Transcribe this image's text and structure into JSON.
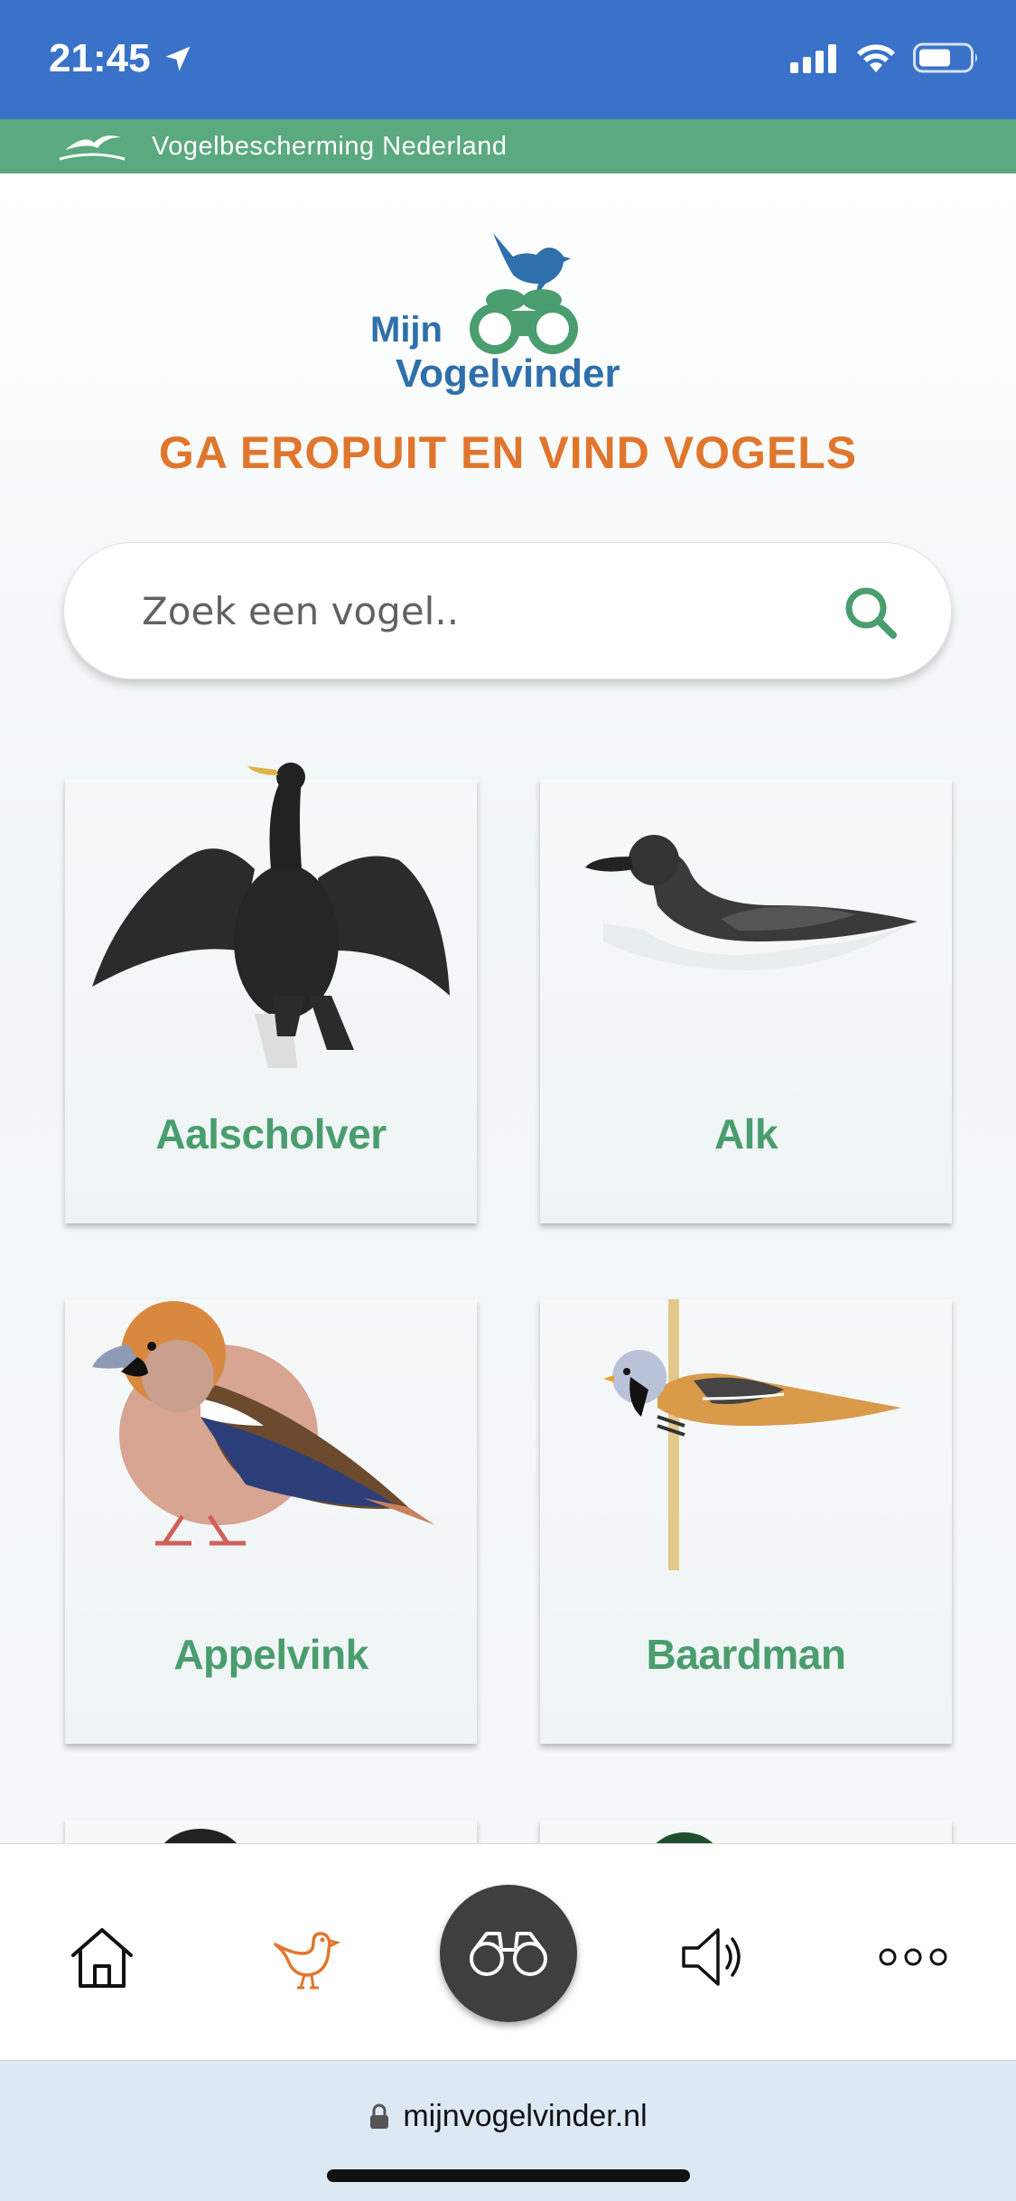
{
  "status_bar": {
    "time": "21:45",
    "icons": [
      "location-arrow-icon",
      "cellular-signal-icon",
      "wifi-icon",
      "battery-icon"
    ]
  },
  "org_bar": {
    "logo_icon": "vogelbescherming-bird-logo-icon",
    "name": "Vogelbescherming Nederland"
  },
  "header": {
    "logo_text_line1": "Mijn",
    "logo_text_line2": "Vogelvinder",
    "tagline": "GA EROPUIT EN VIND VOGELS"
  },
  "search": {
    "placeholder": "Zoek een vogel..",
    "value": "",
    "icon": "search-icon"
  },
  "birds": [
    {
      "name": "Aalscholver",
      "icon": "cormorant-illustration"
    },
    {
      "name": "Alk",
      "icon": "razorbill-illustration"
    },
    {
      "name": "Appelvink",
      "icon": "hawfinch-illustration"
    },
    {
      "name": "Baardman",
      "icon": "bearded-reedling-illustration"
    },
    {
      "name": "",
      "icon": "starling-illustration"
    },
    {
      "name": "",
      "icon": "duck-illustration"
    }
  ],
  "tabbar": {
    "items": [
      {
        "id": "home",
        "icon": "home-icon"
      },
      {
        "id": "birds",
        "icon": "bird-icon",
        "active": true
      },
      {
        "id": "spotting",
        "icon": "binoculars-icon"
      },
      {
        "id": "sounds",
        "icon": "speaker-icon"
      },
      {
        "id": "more",
        "icon": "more-icon"
      }
    ]
  },
  "browser": {
    "url": "mijnvogelvinder.nl",
    "icon": "lock-icon"
  },
  "colors": {
    "status_bar": "#3a72c9",
    "org_bar": "#5aa97f",
    "accent_orange": "#e0762d",
    "bird_name_green": "#4a9d6e",
    "logo_blue": "#2f6fab"
  }
}
